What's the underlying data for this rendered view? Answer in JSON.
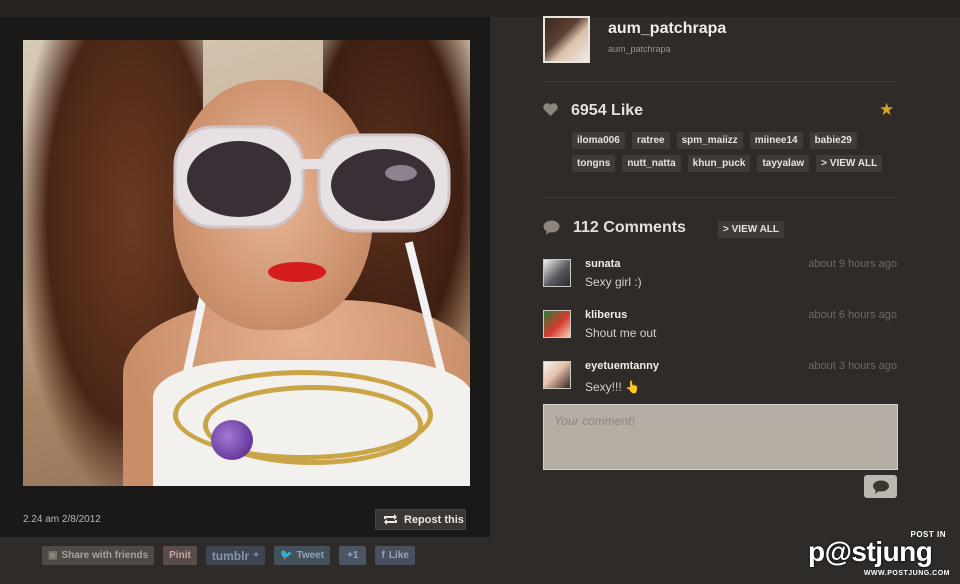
{
  "post": {
    "timestamp": "2.24 am 2/8/2012",
    "repost_label": "Repost this"
  },
  "share": {
    "buttons": [
      {
        "label": "Share with friends",
        "icon": "share-icon"
      },
      {
        "label": "Pinit",
        "icon": "pinterest-icon"
      },
      {
        "label": "tumblr",
        "icon": "tumblr-icon"
      },
      {
        "label": "Tweet",
        "icon": "twitter-icon"
      },
      {
        "label": "+1",
        "icon": "google-plus-icon"
      },
      {
        "label": "Like",
        "icon": "facebook-icon"
      }
    ]
  },
  "profile": {
    "username": "aum_patchrapa",
    "handle": "aum_patchrapa"
  },
  "likes": {
    "count_label": "6954 Like",
    "users": [
      "iloma006",
      "ratree",
      "spm_maiizz",
      "miinee14",
      "babie29",
      "tongns",
      "nutt_natta",
      "khun_puck",
      "tayyalaw"
    ],
    "view_all": "> VIEW ALL"
  },
  "comments": {
    "count_label": "112 Comments",
    "view_all": "> VIEW ALL",
    "items": [
      {
        "user": "sunata",
        "time": "about 9 hours ago",
        "text": "Sexy girl :)"
      },
      {
        "user": "kliberus",
        "time": "about 6 hours ago",
        "text": "Shout me out"
      },
      {
        "user": "eyetuemtanny",
        "time": "about 3 hours ago",
        "text": "Sexy!!! 👆"
      }
    ],
    "input_placeholder": "Your comment!"
  },
  "watermark": {
    "top": "POST IN",
    "logo": "p@stjung",
    "url": "WWW.POSTJUNG.COM"
  },
  "colors": {
    "background": "#2e2b28",
    "panel": "#1b1918",
    "accent_star": "#d5a62a",
    "tag_bg": "#3f3b37"
  }
}
